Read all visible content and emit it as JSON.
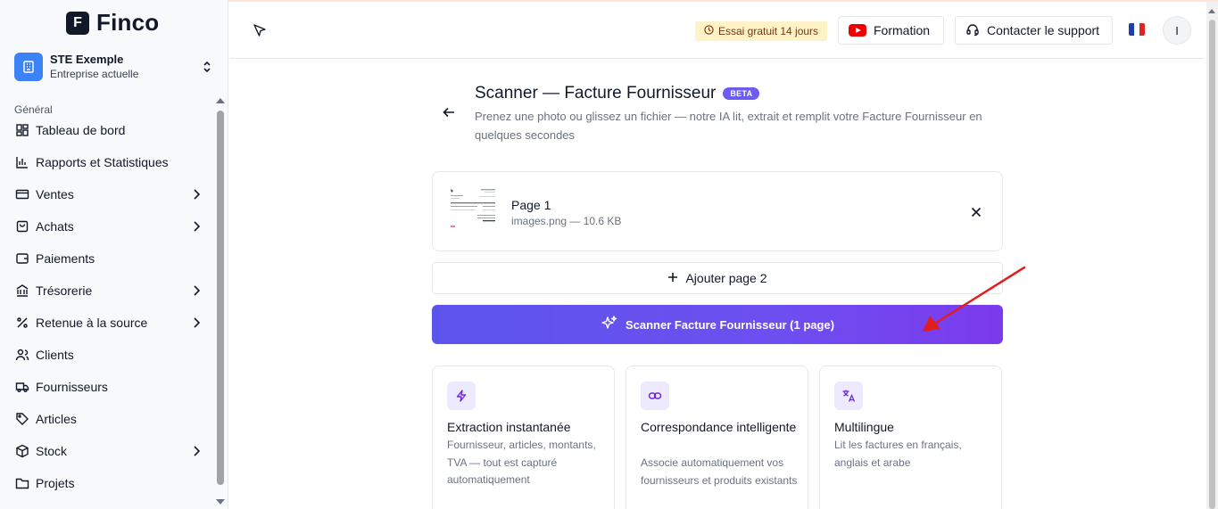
{
  "app": {
    "logo_letter": "F",
    "name": "Finco"
  },
  "company": {
    "name": "STE Exemple",
    "subtitle": "Entreprise actuelle"
  },
  "sidebar": {
    "section": "Général",
    "items": [
      {
        "label": "Tableau de bord",
        "icon": "dashboard-icon",
        "has_children": false
      },
      {
        "label": "Rapports et Statistiques",
        "icon": "bar-chart-icon",
        "has_children": false
      },
      {
        "label": "Ventes",
        "icon": "credit-card-icon",
        "has_children": true
      },
      {
        "label": "Achats",
        "icon": "shopping-bag-icon",
        "has_children": true
      },
      {
        "label": "Paiements",
        "icon": "wallet-icon",
        "has_children": false
      },
      {
        "label": "Trésorerie",
        "icon": "bank-icon",
        "has_children": true
      },
      {
        "label": "Retenue à la source",
        "icon": "percent-icon",
        "has_children": true
      },
      {
        "label": "Clients",
        "icon": "users-icon",
        "has_children": false
      },
      {
        "label": "Fournisseurs",
        "icon": "truck-icon",
        "has_children": false
      },
      {
        "label": "Articles",
        "icon": "tag-icon",
        "has_children": false
      },
      {
        "label": "Stock",
        "icon": "box-icon",
        "has_children": true
      },
      {
        "label": "Projets",
        "icon": "folder-icon",
        "has_children": false
      }
    ]
  },
  "header": {
    "trial_badge": "Essai gratuit 14 jours",
    "formation_label": "Formation",
    "support_label": "Contacter le support",
    "avatar_initial": "I"
  },
  "page": {
    "title": "Scanner — Facture Fournisseur",
    "badge": "BETA",
    "subtitle": "Prenez une photo ou glissez un fichier — notre IA lit, extrait et remplit votre Facture Fournisseur en quelques secondes"
  },
  "file": {
    "page_label": "Page 1",
    "meta": "images.png — 10.6 KB"
  },
  "actions": {
    "add_page_label": "Ajouter page 2",
    "scan_label": "Scanner Facture Fournisseur (1 page)"
  },
  "features": [
    {
      "title": "Extraction instantanée",
      "desc": "Fournisseur, articles, montants, TVA — tout est capturé automatiquement",
      "icon": "lightning-icon"
    },
    {
      "title": "Correspondance intelligente",
      "desc": "Associe automatiquement vos fournisseurs et produits existants",
      "icon": "link-icon"
    },
    {
      "title": "Multilingue",
      "desc": "Lit les factures en français, anglais et arabe",
      "icon": "translate-icon"
    }
  ],
  "colors": {
    "accent": "#6d5cf2",
    "brand_blue": "#3b82f6",
    "annotation_arrow": "#e11d1d",
    "trial_bg": "#fef3c7"
  }
}
